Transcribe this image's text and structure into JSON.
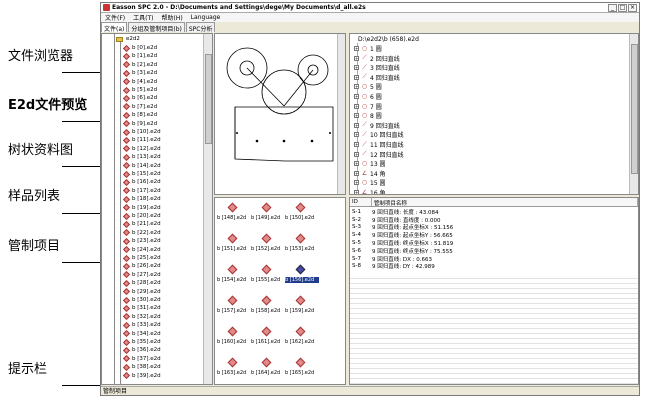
{
  "labels": {
    "file_browser": "文件浏览器",
    "e2d_preview": "E2d文件预览",
    "tree": "树状资料图",
    "sample_list": "样品列表",
    "control_items": "管制项目",
    "tip_bar": "提示栏"
  },
  "window": {
    "title": "Easson SPC 2.0 - D:\\Documents and Settings\\dege\\My Documents\\d_all.e2s",
    "min": "_",
    "max": "□",
    "close": "×"
  },
  "menu": [
    "文件(F)",
    "工具(T)",
    "帮助(H)",
    "Language"
  ],
  "tabs": [
    "文件(a)",
    "分组及管制项目(b)",
    "SPC分析"
  ],
  "files": {
    "root": "e2d2",
    "items": [
      "b [0].e2d",
      "b [1].e2d",
      "b [2].e2d",
      "b [3].e2d",
      "b [4].e2d",
      "b [5].e2d",
      "b [6].e2d",
      "b [7].e2d",
      "b [8].e2d",
      "b [9].e2d",
      "b [10].e2d",
      "b [11].e2d",
      "b [12].e2d",
      "b [13].e2d",
      "b [14].e2d",
      "b [15].e2d",
      "b [16].e2d",
      "b [17].e2d",
      "b [18].e2d",
      "b [19].e2d",
      "b [20].e2d",
      "b [21].e2d",
      "b [22].e2d",
      "b [23].e2d",
      "b [24].e2d",
      "b [25].e2d",
      "b [26].e2d",
      "b [27].e2d",
      "b [28].e2d",
      "b [29].e2d",
      "b [30].e2d",
      "b [31].e2d",
      "b [32].e2d",
      "b [33].e2d",
      "b [34].e2d",
      "b [35].e2d",
      "b [36].e2d",
      "b [37].e2d",
      "b [38].e2d",
      "b [39].e2d"
    ]
  },
  "tree": {
    "root": "D:\\e2d2\\b (658).e2d",
    "items": [
      {
        "label": "1 圆",
        "icon": "circle-icon"
      },
      {
        "label": "2 回归直线",
        "icon": "line-icon"
      },
      {
        "label": "3 回归直线",
        "icon": "line-icon"
      },
      {
        "label": "4 回归直线",
        "icon": "line-icon"
      },
      {
        "label": "5 圆",
        "icon": "circle-icon"
      },
      {
        "label": "6 圆",
        "icon": "circle-icon"
      },
      {
        "label": "7 圆",
        "icon": "circle-icon"
      },
      {
        "label": "8 圆",
        "icon": "circle-icon"
      },
      {
        "label": "9 回归直线",
        "icon": "line-icon"
      },
      {
        "label": "10 回归直线",
        "icon": "line-icon"
      },
      {
        "label": "11 回归直线",
        "icon": "line-icon"
      },
      {
        "label": "12 回归直线",
        "icon": "line-icon"
      },
      {
        "label": "13 圆",
        "icon": "circle-icon"
      },
      {
        "label": "14 角",
        "icon": "angle-icon"
      },
      {
        "label": "15 圆",
        "icon": "circle-icon"
      },
      {
        "label": "16 角",
        "icon": "angle-icon"
      }
    ]
  },
  "samples": {
    "rows": [
      [
        "b [148].e2d",
        "b [149].e2d",
        "b [150].e2d"
      ],
      [
        "b [151].e2d",
        "b [152].e2d",
        "b [153].e2d"
      ],
      [
        "b [154].e2d",
        "b [155].e2d",
        "b [156].e2d"
      ],
      [
        "b [157].e2d",
        "b [158].e2d",
        "b [159].e2d"
      ],
      [
        "b [160].e2d",
        "b [161].e2d",
        "b [162].e2d"
      ],
      [
        "b [163].e2d",
        "b [164].e2d",
        "b [165].e2d"
      ]
    ],
    "selected": "b [156].e2d"
  },
  "control": {
    "headers": [
      "ID",
      "管制项目名称"
    ],
    "rows": [
      {
        "id": "S-1",
        "name": "9 回归直线: 长度 : 43.084"
      },
      {
        "id": "S-2",
        "name": "9 回归直线: 直线度 : 0.000"
      },
      {
        "id": "S-3",
        "name": "9 回归直线: 起点坐标X : 51.156"
      },
      {
        "id": "S-4",
        "name": "9 回归直线: 起点坐标Y : 56.665"
      },
      {
        "id": "S-5",
        "name": "9 回归直线: 终点坐标X : 51.819"
      },
      {
        "id": "S-6",
        "name": "9 回归直线: 终点坐标Y : 75.555"
      },
      {
        "id": "S-7",
        "name": "9 回归直线: DX : 0.663"
      },
      {
        "id": "S-8",
        "name": "9 回归直线: DY : 42.989"
      }
    ]
  },
  "status": "管制项目",
  "colors": {
    "accent_selected": "#1f3b8a",
    "sample_icon": "#e08a8a"
  }
}
